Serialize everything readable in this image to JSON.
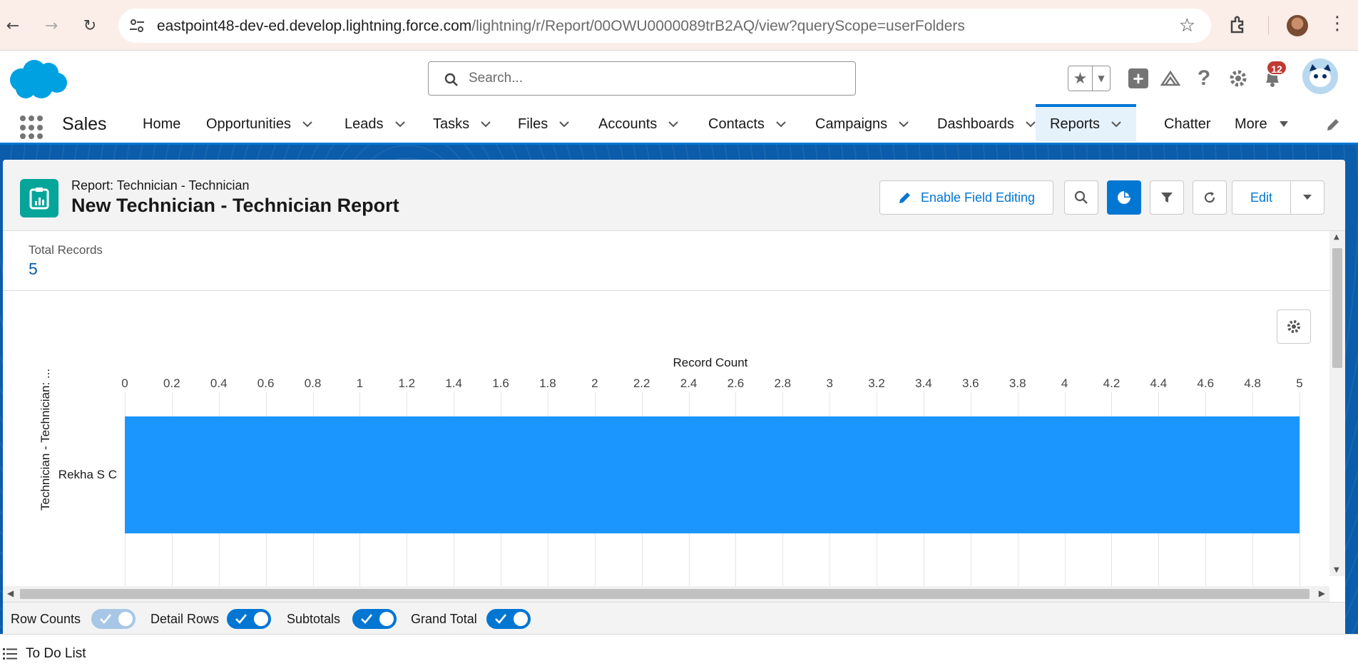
{
  "browser": {
    "url_host": "eastpoint48-dev-ed.develop.lightning.force.com",
    "url_path": "/lightning/r/Report/00OWU0000089trB2AQ/view?queryScope=userFolders"
  },
  "header": {
    "search_placeholder": "Search...",
    "notification_count": "12"
  },
  "nav": {
    "app_name": "Sales",
    "items": [
      {
        "label": "Home",
        "has_menu": false
      },
      {
        "label": "Opportunities",
        "has_menu": true
      },
      {
        "label": "Leads",
        "has_menu": true
      },
      {
        "label": "Tasks",
        "has_menu": true
      },
      {
        "label": "Files",
        "has_menu": true
      },
      {
        "label": "Accounts",
        "has_menu": true
      },
      {
        "label": "Contacts",
        "has_menu": true
      },
      {
        "label": "Campaigns",
        "has_menu": true
      },
      {
        "label": "Dashboards",
        "has_menu": true
      },
      {
        "label": "Reports",
        "has_menu": true,
        "active": true
      },
      {
        "label": "Chatter",
        "has_menu": false
      },
      {
        "label": "More",
        "has_menu": true
      }
    ]
  },
  "report": {
    "subtitle": "Report: Technician - Technician",
    "title": "New Technician - Technician Report",
    "enable_field_editing_label": "Enable Field Editing",
    "edit_label": "Edit",
    "total_records_label": "Total Records",
    "total_records_value": "5"
  },
  "chart_data": {
    "type": "bar",
    "orientation": "horizontal",
    "xlabel": "Record Count",
    "ylabel": "Technician - Technician: ...",
    "categories": [
      "Rekha S C"
    ],
    "values": [
      5
    ],
    "xlim": [
      0,
      5
    ],
    "ticks": [
      "0",
      "0.2",
      "0.4",
      "0.6",
      "0.8",
      "1",
      "1.2",
      "1.4",
      "1.6",
      "1.8",
      "2",
      "2.2",
      "2.4",
      "2.6",
      "2.8",
      "3",
      "3.2",
      "3.4",
      "3.6",
      "3.8",
      "4",
      "4.2",
      "4.4",
      "4.6",
      "4.8",
      "5"
    ],
    "bar_color": "#1b96ff",
    "grid": true
  },
  "footer": {
    "toggles": [
      {
        "label": "Row Counts",
        "on": true,
        "disabled": true
      },
      {
        "label": "Detail Rows",
        "on": true
      },
      {
        "label": "Subtotals",
        "on": true
      },
      {
        "label": "Grand Total",
        "on": true
      }
    ]
  },
  "utility": {
    "todo_label": "To Do List"
  },
  "colors": {
    "brand": "#0176d3",
    "report_icon": "#06a59a",
    "band": "#0b5cab"
  }
}
